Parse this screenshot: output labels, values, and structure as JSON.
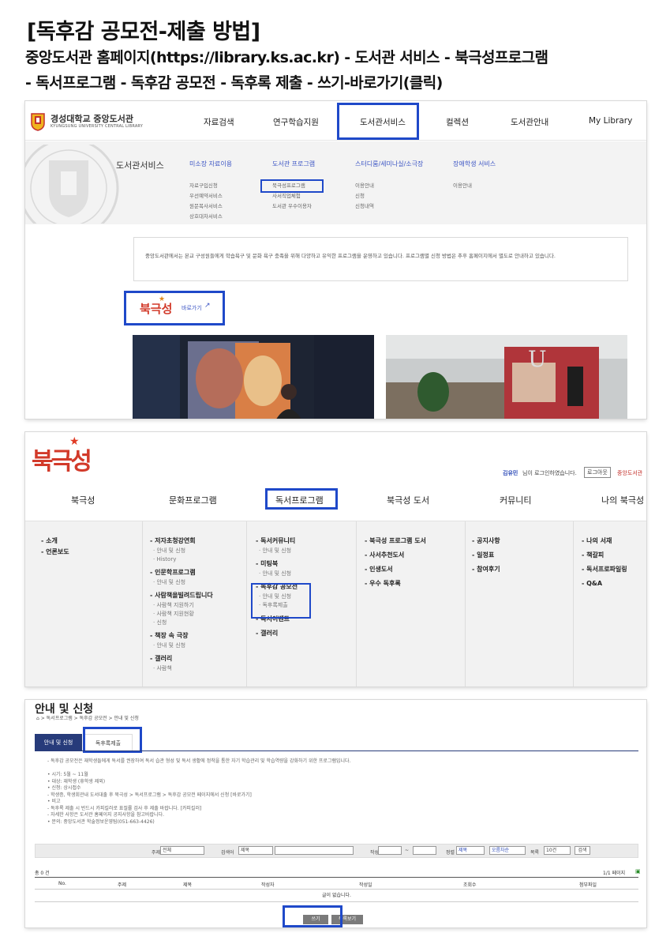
{
  "heading": {
    "title": "[독후감 공모전-제출 방법]",
    "line1": "중앙도서관 홈페이지(https://library.ks.ac.kr) - 도서관 서비스 - 북극성프로그램",
    "line2": "- 독서프로그램 - 독후감 공모전 - 독후록 제출 - 쓰기-바로가기(클릭)"
  },
  "shot1": {
    "logo_ko": "경성대학교 중앙도서관",
    "logo_en": "KYUNGSUNG UNIVERSITY CENTRAL LIBRARY",
    "nav": [
      "자료검색",
      "연구학습지원",
      "도서관서비스",
      "컬렉션",
      "도서관안내",
      "My Library"
    ],
    "panel_title": "도서관서비스",
    "columns": [
      {
        "title": "미소장 자료이용",
        "items": [
          "자료구입신청",
          "우선예약서비스",
          "원문복사서비스",
          "상호대차서비스"
        ]
      },
      {
        "title": "도서관 프로그램",
        "items": [
          "북극성프로그램",
          "사서직업체험",
          "도서관 우수이용자"
        ]
      },
      {
        "title": "스터디룸/세미나실/소극장",
        "items": [
          "이용안내",
          "신청",
          "신청내역"
        ]
      },
      {
        "title": "장애학생 서비스",
        "items": [
          "이용안내"
        ]
      }
    ],
    "notice": "중앙도서관에서는 본교 구성원들에게 학습욕구 및 문화 욕구 충족을 위해 다양하고 유익한 프로그램을 운영하고 있습니다. 프로그램별 신청 방법은 추후 홈페이지에서 별도로 안내하고 있습니다.",
    "shortcut_logo": "북극성",
    "shortcut_label": "바로가기"
  },
  "shot2": {
    "brand": "북극성",
    "login_user": "김유민",
    "login_text": "님이 로그인하였습니다.",
    "logout": "로그아웃",
    "home_link": "중앙도서관",
    "menu": [
      "북극성",
      "문화프로그램",
      "독서프로그램",
      "북극성 도서",
      "커뮤니티",
      "나의 북극성"
    ],
    "col1": [
      "소개",
      "언론보도"
    ],
    "col2": [
      {
        "h": "저자초청강연회",
        "s": [
          "안내 및 신청",
          "History"
        ]
      },
      {
        "h": "인문학프로그램",
        "s": [
          "안내 및 신청"
        ]
      },
      {
        "h": "사람책을빌려드립니다",
        "s": [
          "사람책 지원하기",
          "사람책 지원현황",
          "신청"
        ]
      },
      {
        "h": "책장 속 극장",
        "s": [
          "안내 및 신청"
        ]
      },
      {
        "h": "갤러리",
        "s": [
          "사람책"
        ]
      }
    ],
    "col3": [
      {
        "h": "독서커뮤니티",
        "s": [
          "안내 및 신청"
        ]
      },
      {
        "h": "미팅북",
        "s": [
          "안내 및 신청"
        ]
      },
      {
        "h": "독후감 공모전",
        "s": [
          "안내 및 신청",
          "독후록제출"
        ]
      },
      {
        "h": "독서이벤트",
        "s": []
      },
      {
        "h": "갤러리",
        "s": []
      }
    ],
    "col4": [
      "북극성 프로그램 도서",
      "사서추천도서",
      "인생도서",
      "우수 독후록"
    ],
    "col5": [
      "공지사항",
      "일정표",
      "참여후기"
    ],
    "col6": [
      "나의 서재",
      "책갈피",
      "독서프로파일링",
      "Q&A"
    ]
  },
  "shot3": {
    "page_title": "안내 및 신청",
    "breadcrumb": "⌂ > 독서프로그램 > 독후감 공모전 > 안내 및 신청",
    "tabs": [
      "안내 및 신청",
      "독후록제출"
    ],
    "info": [
      "- 독후감 공모전은 재학생들에게 독서를 권장하여 독서 습관 형성 및 독서 생활에 정착을 통한 자기 학습관리 및 학습역량을 강화하기 위한 프로그램입니다.",
      "",
      "• 시기: 5월 ~ 11월",
      "• 대상: 재학생 (휴학생 제외)",
      "• 신청: 상시접수",
      "  - 학생증, 학생회관내 도서대출 후 북극성 > 독서프로그램 > 독후감 공모전 페이지에서 신청 [바로가기]",
      "• 비고",
      "  - 독후록 제출 시 반드시 카피킬러로 표절률 검사 후 제출 바랍니다. [카피킬러]",
      "  - 자세한 사항은 도서관 홈페이지 공지사항을 참고바랍니다.",
      "• 문의: 중앙도서관 학술정보운영팀(051-663-4426)"
    ],
    "search": {
      "l1": "주제",
      "v1": "전체",
      "l2": "검색어",
      "v2": "제목",
      "l3": "작성일",
      "l4": "정렬",
      "v4": "제목",
      "v5": "오름차순",
      "l6": "목록",
      "v6": "10건",
      "btn": "검색"
    },
    "total": "총 0 건",
    "pages": "1/1 페이지",
    "headers": [
      "No.",
      "주제",
      "제목",
      "작성자",
      "작성일",
      "조회수",
      "첨부파일"
    ],
    "empty": "글이 없습니다.",
    "buttons": [
      "쓰기",
      "목록보기"
    ]
  }
}
